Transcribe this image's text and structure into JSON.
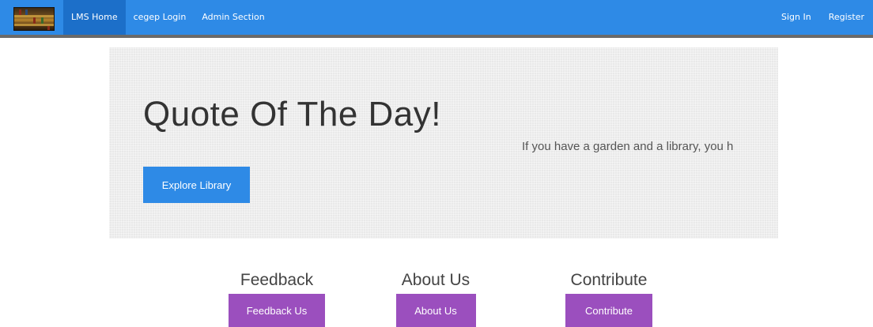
{
  "navbar": {
    "left_items": [
      {
        "label": "LMS Home",
        "active": true
      },
      {
        "label": "cegep Login",
        "active": false
      },
      {
        "label": "Admin Section",
        "active": false
      }
    ],
    "right_items": [
      {
        "label": "Sign In"
      },
      {
        "label": "Register"
      }
    ],
    "colors": {
      "bar": "#2e8ae6",
      "active": "#1c6fc9"
    }
  },
  "jumbotron": {
    "title": "Quote Of The Day!",
    "quote": "If you have a garden and a library, you h",
    "button_label": "Explore Library"
  },
  "cards": [
    {
      "title": "Feedback",
      "button_label": "Feedback Us"
    },
    {
      "title": "About Us",
      "button_label": "About Us"
    },
    {
      "title": "Contribute",
      "button_label": "Contribute"
    }
  ],
  "colors": {
    "card_button": "#9b4fbe",
    "primary_button": "#2e8ae6"
  }
}
